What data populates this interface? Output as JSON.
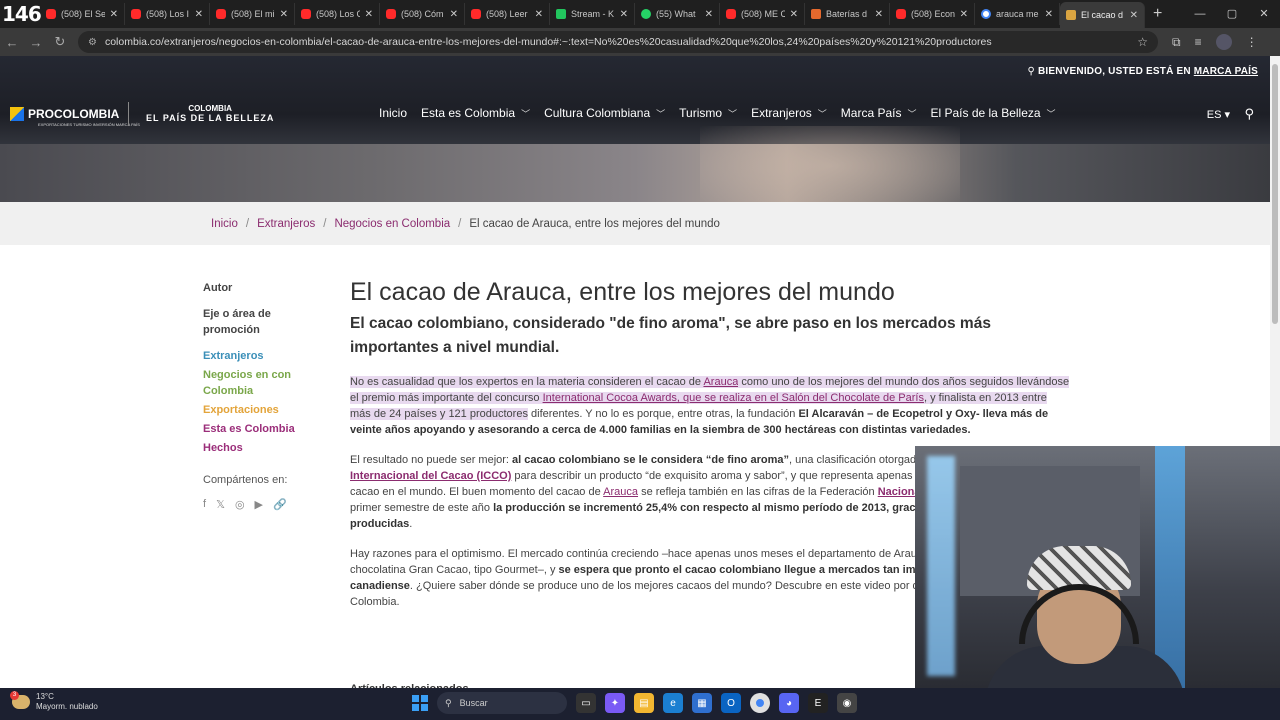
{
  "browser": {
    "tab_counter": "146",
    "tabs": [
      {
        "title": "(508) El Se",
        "fav": "fav-yt"
      },
      {
        "title": "(508) Los I",
        "fav": "fav-yt"
      },
      {
        "title": "(508) El mi",
        "fav": "fav-yt"
      },
      {
        "title": "(508) Los C",
        "fav": "fav-yt"
      },
      {
        "title": "(508) Cóm",
        "fav": "fav-yt"
      },
      {
        "title": "(508) Leer",
        "fav": "fav-yt"
      },
      {
        "title": "Stream - K",
        "fav": "fav-green"
      },
      {
        "title": "(55) What",
        "fav": "fav-wa"
      },
      {
        "title": "(508) ME C",
        "fav": "fav-yt"
      },
      {
        "title": "Baterías d",
        "fav": "fav-orange"
      },
      {
        "title": "(508) Econ",
        "fav": "fav-yt"
      },
      {
        "title": "arauca me",
        "fav": "fav-g"
      },
      {
        "title": "El cacao d",
        "fav": "fav-pc",
        "active": true
      }
    ],
    "url": "colombia.co/extranjeros/negocios-en-colombia/el-cacao-de-arauca-entre-los-mejores-del-mundo#:~:text=No%20es%20casualidad%20que%20los,24%20países%20y%20121%20productores"
  },
  "header": {
    "welcome_prefix": "BIENVENIDO, USTED ESTÁ EN",
    "welcome_link": "MARCA PAÍS",
    "logo_pro": "PROCOLOMBIA",
    "logo_pro_sub": "EXPORTACIONES TURISMO INVERSIÓN MARCA PAÍS",
    "logo_col_l1": "COLOMBIA",
    "logo_col_l2": "EL PAÍS DE LA BELLEZA",
    "nav": [
      {
        "label": "Inicio",
        "dropdown": false
      },
      {
        "label": "Esta es Colombia",
        "dropdown": true
      },
      {
        "label": "Cultura Colombiana",
        "dropdown": true
      },
      {
        "label": "Turismo",
        "dropdown": true
      },
      {
        "label": "Extranjeros",
        "dropdown": true
      },
      {
        "label": "Marca País",
        "dropdown": true
      },
      {
        "label": "El País de la Belleza",
        "dropdown": true
      }
    ],
    "lang": "ES"
  },
  "breadcrumb": {
    "items": [
      "Inicio",
      "Extranjeros",
      "Negocios en Colombia"
    ],
    "current": "El cacao de Arauca, entre los mejores del mundo"
  },
  "sidebar": {
    "autor_label": "Autor",
    "eje_label": "Eje o área de promoción",
    "tags": [
      {
        "label": "Extranjeros",
        "color": "blue"
      },
      {
        "label": "Negocios en con Colombia",
        "color": "green"
      },
      {
        "label": "Exportaciones",
        "color": "orange"
      },
      {
        "label": "Esta es Colombia",
        "color": "magenta"
      },
      {
        "label": "Hechos",
        "color": "magenta"
      }
    ],
    "share_label": "Compártenos en:"
  },
  "article": {
    "title": "El cacao de Arauca, entre los mejores del mundo",
    "subtitle": "El cacao colombiano, considerado \"de fino aroma\", se abre paso en los mercados más importantes a nivel mundial.",
    "p1": {
      "h1": "No es casualidad que los expertos en la materia consideren el cacao de ",
      "h1_link": "Arauca",
      "h2": " como uno de los mejores del mundo dos años seguidos llevándose el premio más importante del concurso ",
      "h2_link": "International Cocoa Awards, que se realiza en el Salón del Chocolate de París",
      "h3": ", y finalista en 2013 entre más de 24 países y 121 productores",
      "t1": " diferentes. Y no lo es porque, entre otras, la fundación ",
      "b1": "El Alcaraván – de Ecopetrol y Oxy- lleva más de veinte años apoyando y asesorando a cerca de 4.000 familias en la siembra de 300 hectáreas con distintas variedades."
    },
    "p2": {
      "t1": "El resultado no puede ser mejor: ",
      "b1": "al cacao colombiano se le considera “de fino aroma”",
      "t2": ", una clasificación otorgada por la Organización ",
      "l1": "Internacional del Cacao (ICCO)",
      "t3": " para describir un producto “de exquisito aroma y sabor”, y que representa apenas el 5% de la producción de cacao en el mundo. El buen momento del cacao de ",
      "l2": "Arauca",
      "t4": " se refleja también en las cifras de la Federación ",
      "l3": "Nacional de Cacaoteros",
      "t5": ", durante el primer semestre de este año ",
      "b2": "la producción se incrementó 25,4% con respecto al mismo período de 2013, gracias a las 25.232 toneladas producidas",
      "t6": "."
    },
    "p3": {
      "t1": "Hay razones para el optimismo. El mercado continúa creciendo –hace apenas unos meses el departamento de Arauca ganó en Agroexpo la chocolatina Gran Cacao, tipo Gourmet–, y ",
      "b1": "se espera que pronto el cacao colombiano llegue a mercados tan importantes como el canadiense",
      "t2": ". ¿Quiere saber dónde se produce uno de los mejores cacaos del mundo? Descubre en este video por qué hace parte de lo mejor de Colombia."
    },
    "related": "Artículos relacionados"
  },
  "taskbar": {
    "temp": "13°C",
    "weather": "Mayorm. nublado",
    "weather_badge": "3",
    "search": "Buscar"
  }
}
